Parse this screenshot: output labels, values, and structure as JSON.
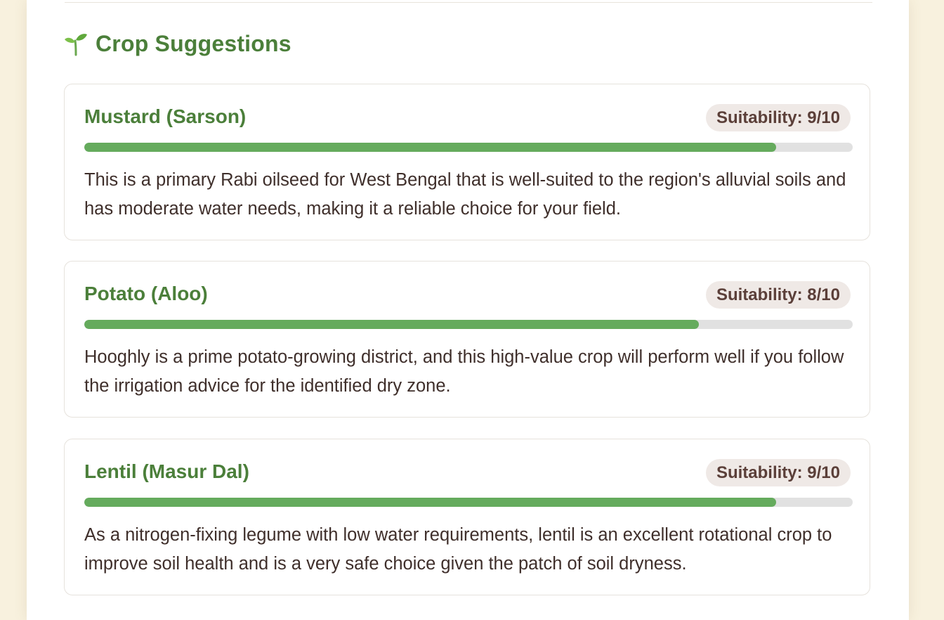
{
  "section": {
    "icon": "sprout-icon",
    "title": "Crop Suggestions"
  },
  "colors": {
    "accent_green": "#4b7f3a",
    "bar_fill": "#65ab5d",
    "bar_track": "#e1e1e1",
    "badge_bg": "#efe9e6",
    "badge_text": "#5b3f39",
    "body_text": "#3f2f2b",
    "page_bg": "#f8f1de"
  },
  "crops": [
    {
      "name": "Mustard (Sarson)",
      "suitability_label": "Suitability: 9/10",
      "suitability": 9,
      "suitability_max": 10,
      "description": "This is a primary Rabi oilseed for West Bengal that is well-suited to the region's alluvial soils and has moderate water needs, making it a reliable choice for your field."
    },
    {
      "name": "Potato (Aloo)",
      "suitability_label": "Suitability: 8/10",
      "suitability": 8,
      "suitability_max": 10,
      "description": "Hooghly is a prime potato-growing district, and this high-value crop will perform well if you follow the irrigation advice for the identified dry zone."
    },
    {
      "name": "Lentil (Masur Dal)",
      "suitability_label": "Suitability: 9/10",
      "suitability": 9,
      "suitability_max": 10,
      "description": "As a nitrogen-fixing legume with low water requirements, lentil is an excellent rotational crop to improve soil health and is a very safe choice given the patch of soil dryness."
    }
  ]
}
